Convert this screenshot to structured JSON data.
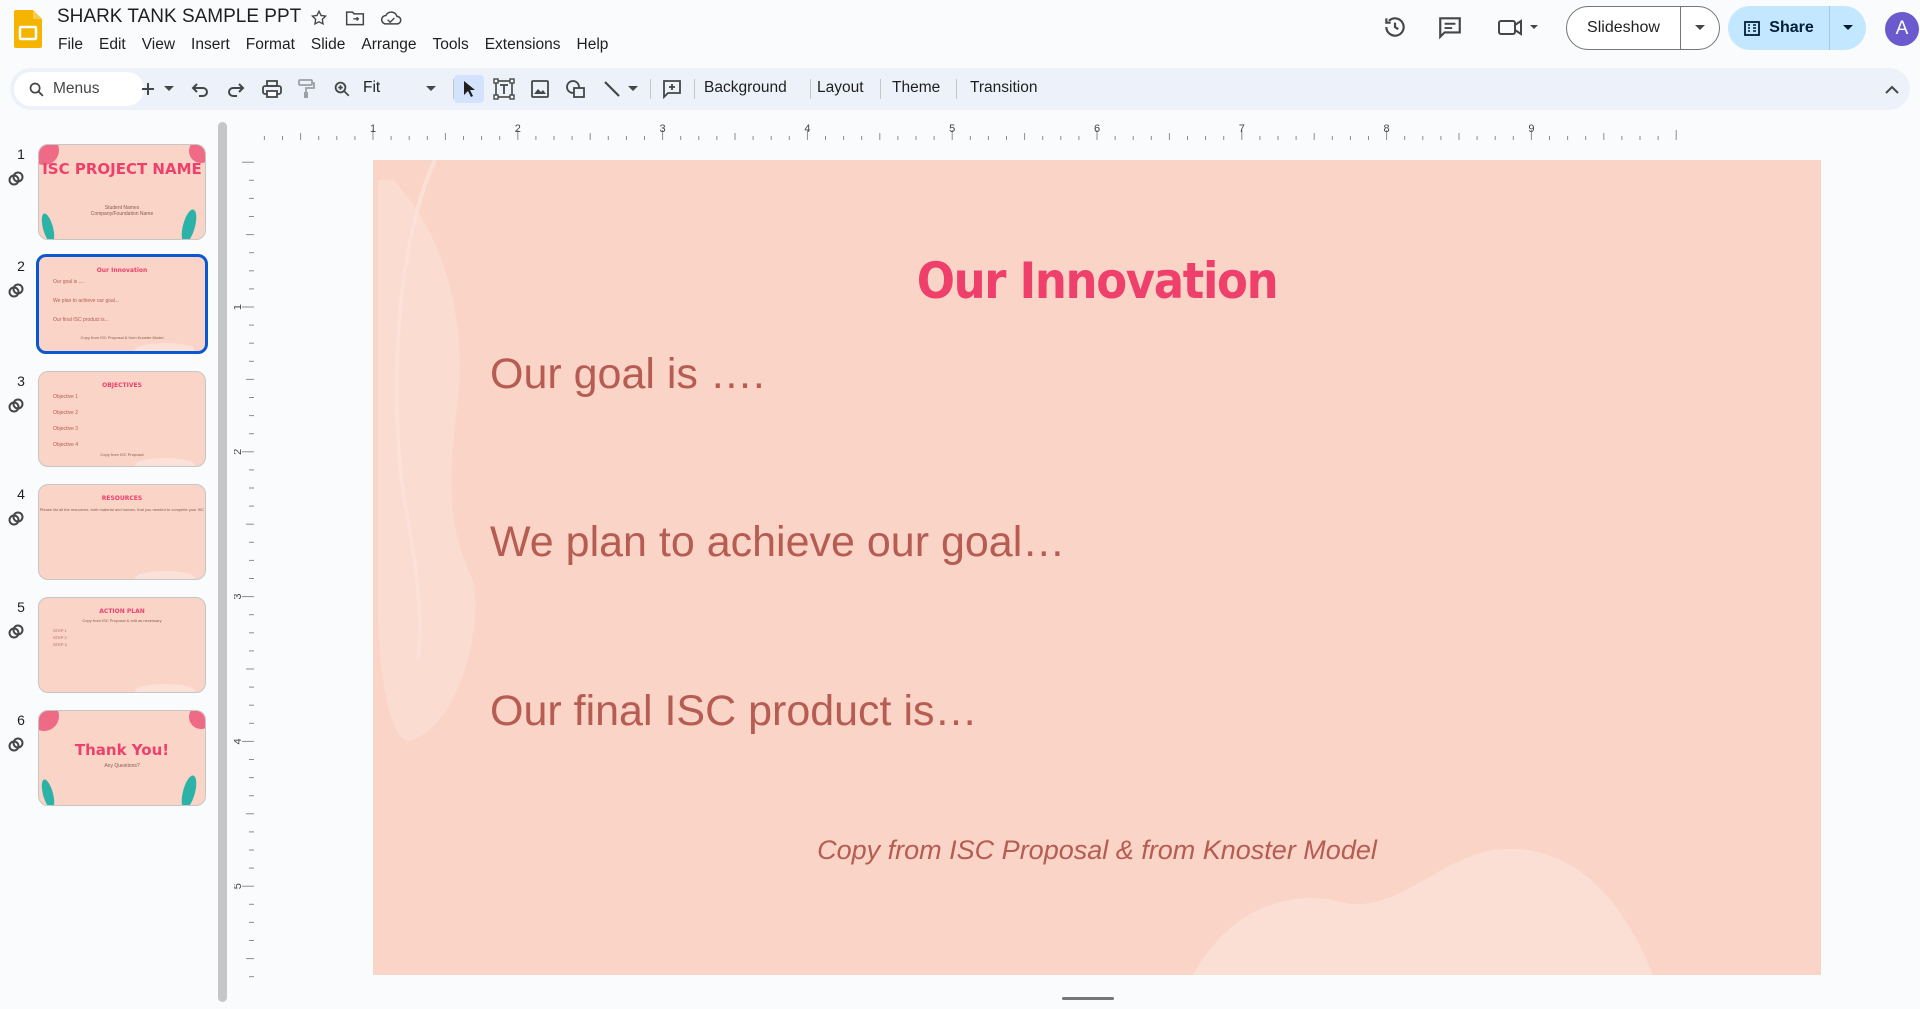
{
  "app": {
    "title": "SHARK TANK SAMPLE PPT",
    "menus": [
      "File",
      "Edit",
      "View",
      "Insert",
      "Format",
      "Slide",
      "Arrange",
      "Tools",
      "Extensions",
      "Help"
    ],
    "slideshow_label": "Slideshow",
    "share_label": "Share",
    "avatar_letter": "A"
  },
  "toolbar": {
    "menus_label": "Menus",
    "zoom_label": "Fit",
    "background_label": "Background",
    "layout_label": "Layout",
    "theme_label": "Theme",
    "transition_label": "Transition"
  },
  "ruler": {
    "horizontal": [
      "1",
      "2",
      "3",
      "4",
      "5",
      "6",
      "7",
      "8",
      "9"
    ],
    "vertical": [
      "1",
      "2",
      "3",
      "4",
      "5"
    ]
  },
  "filmstrip": {
    "slides": [
      {
        "number": "1",
        "title": "ISC PROJECT NAME",
        "lines": [
          "Student Names",
          "Company/Foundation Name"
        ]
      },
      {
        "number": "2",
        "title": "Our Innovation",
        "lines": [
          "Our goal is ....",
          "We plan to achieve our goal...",
          "Our final ISC product is...",
          "Copy from ISC Proposal & from Knoster Model"
        ]
      },
      {
        "number": "3",
        "title": "OBJECTIVES",
        "lines": [
          "Objective 1",
          "Objective 2",
          "Objective 3",
          "Objective 4",
          "Copy from ISC Proposal"
        ]
      },
      {
        "number": "4",
        "title": "RESOURCES",
        "lines": [
          "Please list all the resources, both material and human, that you needed to complete your ISC"
        ]
      },
      {
        "number": "5",
        "title": "ACTION PLAN",
        "lines": [
          "Copy from ISC Proposal & edit as necessary",
          "STEP 1",
          "STEP 2",
          "STEP 3"
        ]
      },
      {
        "number": "6",
        "title": "Thank You!",
        "lines": [
          "Any Questions?"
        ]
      }
    ]
  },
  "slide": {
    "title": "Our Innovation",
    "line1": "Our goal is ….",
    "line2": "We plan to achieve our goal…",
    "line3": "Our final ISC product is…",
    "footer": "Copy from ISC Proposal & from Knoster Model"
  },
  "colors": {
    "slide_bg": "#f9d4c7",
    "accent_pink": "#ef3f6b",
    "body_text": "#b65c52",
    "selection_blue": "#0b57d0"
  }
}
